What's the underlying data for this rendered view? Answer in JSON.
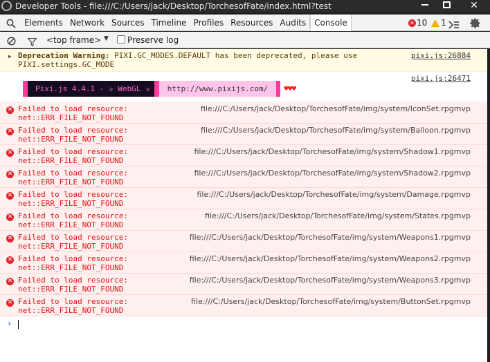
{
  "window": {
    "title": "Developer Tools - file:///C:/Users/jack/Desktop/TorchesofFate/index.html?test",
    "close_glyph": "✕"
  },
  "tabs": [
    "Elements",
    "Network",
    "Sources",
    "Timeline",
    "Profiles",
    "Resources",
    "Audits",
    "Console"
  ],
  "active_tab": "Console",
  "counts": {
    "errors": "10",
    "warnings": "1"
  },
  "toolbar": {
    "frame": "<top frame>",
    "preserve_log": "Preserve log",
    "preserve_checked": false
  },
  "warning": {
    "label": "Deprecation Warning:",
    "text": "PIXI.GC_MODES.DEFAULT has been deprecated, please use PIXI.settings.GC_MODE",
    "source": "pixi.js:26884"
  },
  "banner": {
    "source": "pixi.js:26471",
    "name": "Pixi.js 4.4.1 - ✰ WebGL ✰",
    "url": "http://www.pixijs.com/",
    "hearts": "♥♥♥"
  },
  "error_line1": "Failed to load resource:",
  "error_line2": "net::ERR_FILE_NOT_FOUND",
  "errors": [
    "file:///C:/Users/jack/Desktop/TorchesofFate/img/system/IconSet.rpgmvp",
    "file:///C:/Users/jack/Desktop/TorchesofFate/img/system/Balloon.rpgmvp",
    "file:///C:/Users/jack/Desktop/TorchesofFate/img/system/Shadow1.rpgmvp",
    "file:///C:/Users/jack/Desktop/TorchesofFate/img/system/Shadow2.rpgmvp",
    "file:///C:/Users/jack/Desktop/TorchesofFate/img/system/Damage.rpgmvp",
    "file:///C:/Users/jack/Desktop/TorchesofFate/img/system/States.rpgmvp",
    "file:///C:/Users/jack/Desktop/TorchesofFate/img/system/Weapons1.rpgmvp",
    "file:///C:/Users/jack/Desktop/TorchesofFate/img/system/Weapons2.rpgmvp",
    "file:///C:/Users/jack/Desktop/TorchesofFate/img/system/Weapons3.rpgmvp",
    "file:///C:/Users/jack/Desktop/TorchesofFate/img/system/ButtonSet.rpgmvp"
  ],
  "prompt": "›",
  "colors": {
    "error": "#e01414",
    "warning_bg": "#fffbe5",
    "error_bg": "#fff0f0",
    "banner_pink": "#ff3b9d"
  }
}
